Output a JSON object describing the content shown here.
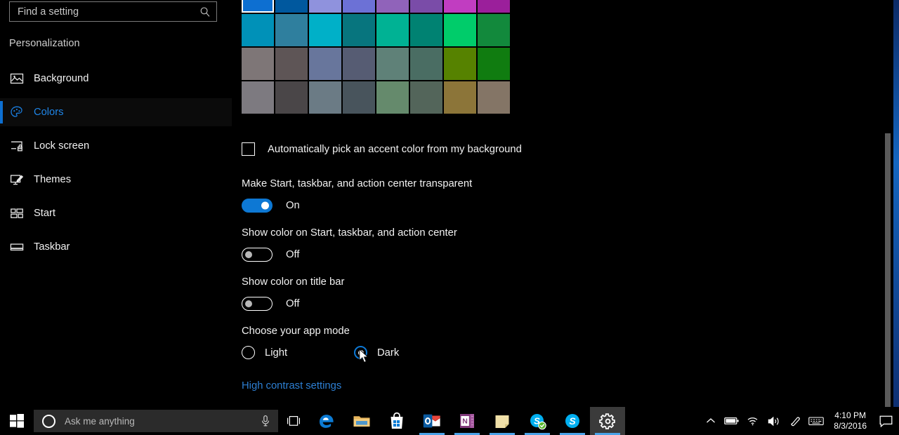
{
  "search": {
    "placeholder": "Find a setting",
    "value": "",
    "icon": "search-icon"
  },
  "sidebar": {
    "header": "Personalization",
    "items": [
      {
        "label": "Background",
        "icon": "picture-icon",
        "selected": false
      },
      {
        "label": "Colors",
        "icon": "palette-icon",
        "selected": true
      },
      {
        "label": "Lock screen",
        "icon": "lock-screen-icon",
        "selected": false
      },
      {
        "label": "Themes",
        "icon": "themes-icon",
        "selected": false
      },
      {
        "label": "Start",
        "icon": "start-tiles-icon",
        "selected": false
      },
      {
        "label": "Taskbar",
        "icon": "taskbar-icon",
        "selected": false
      }
    ]
  },
  "main": {
    "accent_swatches": {
      "selected_index": 0,
      "rows": [
        [
          "#0d6fd1",
          "#00589e",
          "#8f92dd",
          "#6c71d6",
          "#9063ba",
          "#7a4ca8",
          "#c13dc1",
          "#9b1f9b"
        ],
        [
          "#0091b8",
          "#2f7f9e",
          "#00b0c8",
          "#07757e",
          "#00b294",
          "#008272",
          "#00cc6a",
          "#12893c"
        ],
        [
          "#7e7677",
          "#5e5556",
          "#68769c",
          "#565c73",
          "#5f8178",
          "#4a6d63",
          "#568200",
          "#107c10"
        ],
        [
          "#7d7a80",
          "#4a4648",
          "#6b7b85",
          "#48545c",
          "#658a6c",
          "#53655a",
          "#8c7539",
          "#847566"
        ]
      ]
    },
    "auto_accent": {
      "label": "Automatically pick an accent color from my background",
      "checked": false
    },
    "settings": [
      {
        "title": "Make Start, taskbar, and action center transparent",
        "state": "on",
        "state_label": "On"
      },
      {
        "title": "Show color on Start, taskbar, and action center",
        "state": "off",
        "state_label": "Off"
      },
      {
        "title": "Show color on title bar",
        "state": "off",
        "state_label": "Off"
      }
    ],
    "app_mode": {
      "title": "Choose your app mode",
      "options": [
        {
          "label": "Light",
          "selected": false
        },
        {
          "label": "Dark",
          "selected": true
        }
      ]
    },
    "high_contrast_link": "High contrast settings",
    "accent_color": "#0d78d4",
    "link_color": "#2d7fd3"
  },
  "taskbar": {
    "start_label": "Start",
    "cortana": {
      "placeholder": "Ask me anything",
      "value": "",
      "mic_icon": "microphone-icon",
      "circle_icon": "cortana-circle-icon"
    },
    "task_view_label": "Task View",
    "apps": [
      {
        "name": "Microsoft Edge",
        "icon": "edge-icon",
        "running": false,
        "active": false
      },
      {
        "name": "File Explorer",
        "icon": "file-explorer-icon",
        "running": false,
        "active": false
      },
      {
        "name": "Microsoft Store",
        "icon": "store-icon",
        "running": false,
        "active": false
      },
      {
        "name": "Outlook",
        "icon": "outlook-icon",
        "running": true,
        "active": false
      },
      {
        "name": "OneNote",
        "icon": "onenote-icon",
        "running": true,
        "active": false
      },
      {
        "name": "Sticky Notes",
        "icon": "sticky-notes-icon",
        "running": true,
        "active": false
      },
      {
        "name": "Skype for Business",
        "icon": "skype-business-icon",
        "running": true,
        "active": false
      },
      {
        "name": "Skype",
        "icon": "skype-icon",
        "running": true,
        "active": false
      },
      {
        "name": "Settings",
        "icon": "settings-gear-icon",
        "running": true,
        "active": true
      }
    ],
    "tray": [
      {
        "name": "show-hidden-icons",
        "icon": "chevron-up-icon"
      },
      {
        "name": "battery",
        "icon": "battery-icon"
      },
      {
        "name": "network",
        "icon": "wifi-icon"
      },
      {
        "name": "volume",
        "icon": "speaker-icon"
      },
      {
        "name": "pen-workspace",
        "icon": "pen-icon"
      },
      {
        "name": "touch-keyboard",
        "icon": "keyboard-icon"
      }
    ],
    "clock": {
      "time": "4:10 PM",
      "date": "8/3/2016"
    },
    "action_center_label": "Action Center"
  }
}
